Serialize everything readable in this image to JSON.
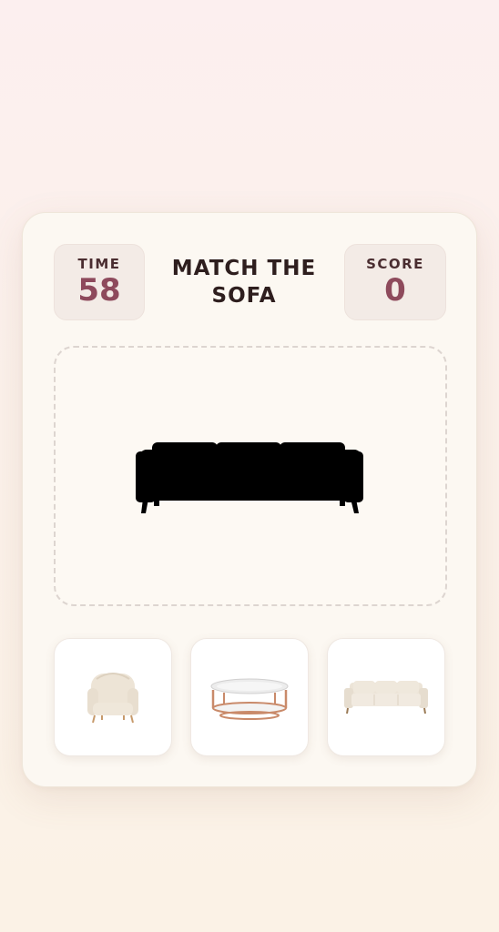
{
  "header": {
    "time_label": "TIME",
    "time_value": "58",
    "title": "MATCH THE SOFA",
    "score_label": "SCORE",
    "score_value": "0"
  },
  "target": {
    "silhouette": "three-seat-sofa-silhouette"
  },
  "options": [
    {
      "item": "armchair",
      "icon": "armchair-icon"
    },
    {
      "item": "coffee-table",
      "icon": "coffee-table-icon"
    },
    {
      "item": "sofa",
      "icon": "sofa-icon"
    }
  ],
  "colors": {
    "accent": "#8e4a5c",
    "title": "#2e1e1e",
    "card": "#fcf8f2",
    "silhouette": "#000000"
  }
}
